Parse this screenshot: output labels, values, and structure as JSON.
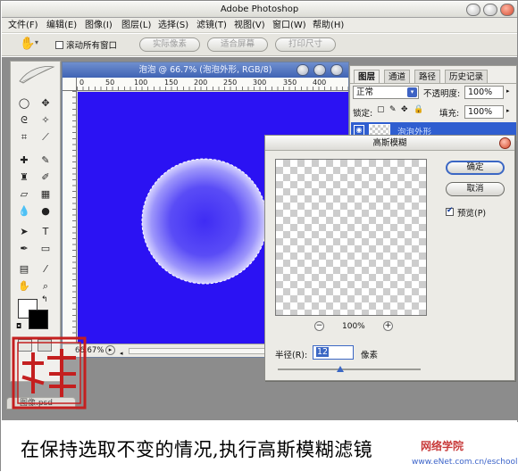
{
  "app": {
    "title": "Adobe Photoshop"
  },
  "menu": {
    "items": [
      "文件(F)",
      "编辑(E)",
      "图像(I)",
      "图层(L)",
      "选择(S)",
      "滤镜(T)",
      "视图(V)",
      "窗口(W)",
      "帮助(H)"
    ]
  },
  "options": {
    "scroll_all": "滚动所有窗口",
    "actual_pixels": "实际像素",
    "fit_screen": "适合屏幕",
    "print_size": "打印尺寸"
  },
  "document": {
    "title": "泡泡 @ 66.7% (泡泡外形, RGB/8)",
    "ruler_labels": [
      "0",
      "50",
      "100",
      "150",
      "200",
      "250",
      "300",
      "350",
      "400"
    ],
    "zoom_status": "66.67%",
    "tab_name": "图像.psd",
    "canvas_color": "#2b12f3"
  },
  "layers_panel": {
    "tabs": [
      "图层",
      "通道",
      "路径",
      "历史记录"
    ],
    "blend_mode": "正常",
    "opacity_label": "不透明度:",
    "opacity_value": "100%",
    "lock_label": "锁定:",
    "fill_label": "填充:",
    "fill_value": "100%",
    "layer_name": "泡泡外形"
  },
  "dialog": {
    "title": "高斯模糊",
    "ok": "确定",
    "cancel": "取消",
    "preview_label": "预览(P)",
    "preview_checked": true,
    "zoom": "100%",
    "radius_label": "半径(R):",
    "radius_value": "12",
    "unit": "像素"
  },
  "caption": "在保持选取不变的情况,执行高斯模糊滤镜",
  "watermark": {
    "line1": "网络学院",
    "line2": "www.eNet.com.cn/eschool"
  },
  "colors": {
    "accent": "#3b67c4",
    "canvas": "#2b12f3",
    "stamp": "#c41f1f"
  }
}
